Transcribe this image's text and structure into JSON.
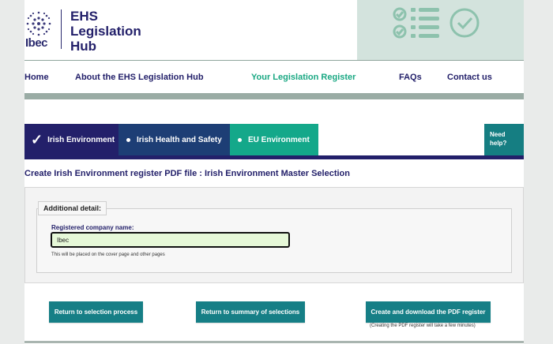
{
  "brand": {
    "logo_text": "Ibec",
    "title_lines": [
      "EHS",
      "Legislation",
      "Hub"
    ]
  },
  "nav": {
    "items": [
      {
        "label": "Home",
        "active": false
      },
      {
        "label": "About the EHS Legislation Hub",
        "active": false
      },
      {
        "label": "Your Legislation Register",
        "active": true
      },
      {
        "label": "FAQs",
        "active": false
      },
      {
        "label": "Contact us",
        "active": false
      }
    ]
  },
  "tabs": {
    "items": [
      {
        "label": "Irish Environment",
        "selected": true,
        "color": "#23206a"
      },
      {
        "label": "Irish Health and Safety",
        "selected": false,
        "color": "#1d3e75"
      },
      {
        "label": "EU Environment",
        "selected": false,
        "color": "#14a88a"
      }
    ],
    "help_lines": [
      "Need",
      "help?"
    ]
  },
  "page": {
    "heading": "Create Irish Environment register PDF file : Irish Environment Master Selection"
  },
  "form": {
    "legend": "Additional detail:",
    "company_label": "Registered company name:",
    "company_value": "Ibec",
    "company_hint": "This will be placed on the cover page and other pages"
  },
  "actions": {
    "return_selection": "Return to selection process",
    "return_summary": "Return to summary of selections",
    "create_pdf": "Create and download the PDF register",
    "create_note": "(Creating the PDF register will take a few minutes)"
  },
  "colors": {
    "navy": "#23206a",
    "teal": "#167f86",
    "green_active": "#1aa883",
    "hero_bg": "#d3e3dd"
  }
}
